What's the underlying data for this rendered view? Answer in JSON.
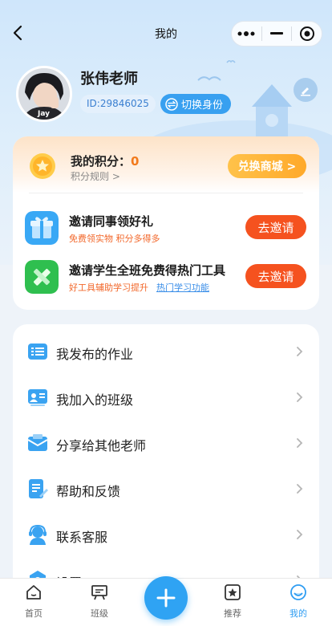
{
  "nav": {
    "title": "我的"
  },
  "profile": {
    "name": "张伟老师",
    "id_text": "ID:29846025",
    "switch_label": "切换身份",
    "avatar_caption": "Jay"
  },
  "points": {
    "label": "我的积分：",
    "value": "0",
    "rule": "积分规则 >",
    "exchange_label": "兑换商城 >"
  },
  "invites": [
    {
      "title": "邀请同事领好礼",
      "subtitle": "免费领实物 积分多得多",
      "button": "去邀请"
    },
    {
      "title": "邀请学生全班免费得热门工具",
      "subtitle": "好工具辅助学习提升",
      "link": "热门学习功能",
      "button": "去邀请"
    }
  ],
  "menu": [
    {
      "label": "我发布的作业",
      "icon": "homework-list-icon"
    },
    {
      "label": "我加入的班级",
      "icon": "class-board-icon"
    },
    {
      "label": "分享给其他老师",
      "icon": "envelope-share-icon"
    },
    {
      "label": "帮助和反馈",
      "icon": "feedback-edit-icon"
    },
    {
      "label": "联系客服",
      "icon": "customer-service-icon"
    },
    {
      "label": "设置",
      "icon": "settings-icon"
    }
  ],
  "tabbar": {
    "items": [
      {
        "label": "首页",
        "icon": "home-icon"
      },
      {
        "label": "班级",
        "icon": "class-icon"
      },
      {
        "label": "推荐",
        "icon": "star-icon"
      },
      {
        "label": "我的",
        "icon": "profile-face-icon"
      }
    ],
    "active_index": 3
  },
  "colors": {
    "accent": "#2f9df2",
    "orange": "#f5521f",
    "gold": "#ffb23a"
  }
}
